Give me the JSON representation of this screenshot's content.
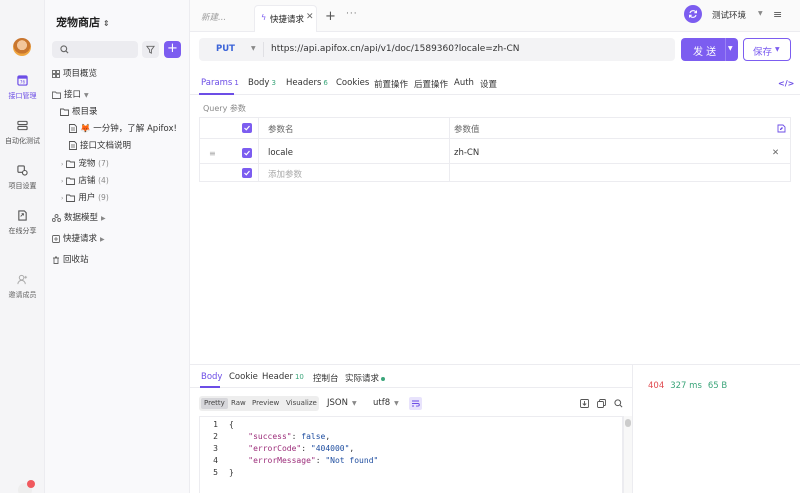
{
  "rail": {
    "items": [
      {
        "label": "接口管理",
        "icon": "api-icon",
        "active": true
      },
      {
        "label": "自动化测试",
        "icon": "automation-icon",
        "active": false
      },
      {
        "label": "项目设置",
        "icon": "settings-icon",
        "active": false
      },
      {
        "label": "在线分享",
        "icon": "share-icon",
        "active": false
      },
      {
        "label": "邀请成员",
        "icon": "invite-icon",
        "active": false
      }
    ],
    "notification_count": "1"
  },
  "panel": {
    "project_name": "宠物商店",
    "search": {
      "placeholder": ""
    },
    "overview": "项目概览",
    "api_section": "接口",
    "root_dir": "根目录",
    "docs": [
      "🦊 一分钟，了解 Apifox!",
      "接口文档说明"
    ],
    "folders": [
      {
        "name": "宠物",
        "count": "(7)"
      },
      {
        "name": "店铺",
        "count": "(4)"
      },
      {
        "name": "用户",
        "count": "(9)"
      }
    ],
    "data_models": "数据模型",
    "quick_requests": "快捷请求",
    "recycle_bin": "回收站"
  },
  "tabs": {
    "new_tab": "新建...",
    "active_tab": "快捷请求",
    "more": "···",
    "environment": "测试环境"
  },
  "request": {
    "method": "PUT",
    "url": "https://api.apifox.cn/api/v1/doc/1589360?locale=zh-CN",
    "send_label": "发 送",
    "save_label": "保存"
  },
  "request_tabs": [
    {
      "label": "Params",
      "count": "1",
      "active": true
    },
    {
      "label": "Body",
      "count": "3"
    },
    {
      "label": "Headers",
      "count": "6"
    },
    {
      "label": "Cookies",
      "count": ""
    },
    {
      "label": "前置操作",
      "count": ""
    },
    {
      "label": "后置操作",
      "count": ""
    },
    {
      "label": "Auth",
      "count": ""
    },
    {
      "label": "设置",
      "count": ""
    }
  ],
  "query": {
    "title": "Query 参数",
    "header_name": "参数名",
    "header_value": "参数值",
    "rows": [
      {
        "name": "locale",
        "value": "zh-CN",
        "checked": true
      }
    ],
    "add_placeholder": "添加参数"
  },
  "response_tabs": [
    {
      "label": "Body",
      "count": "",
      "active": true
    },
    {
      "label": "Cookie",
      "count": ""
    },
    {
      "label": "Header",
      "count": "10"
    },
    {
      "label": "控制台",
      "count": ""
    },
    {
      "label": "实际请求",
      "count": ""
    }
  ],
  "response": {
    "status_code": "404",
    "time": "327 ms",
    "size": "65 B",
    "formats": [
      "Pretty",
      "Raw",
      "Preview",
      "Visualize"
    ],
    "active_format": "Pretty",
    "language": "JSON",
    "encoding": "utf8",
    "line_numbers": [
      "1",
      "2",
      "3",
      "4",
      "5"
    ],
    "body": {
      "open": "{",
      "lines": [
        {
          "key": "\"success\"",
          "value": "false"
        },
        {
          "key": "\"errorCode\"",
          "value": "\"404000\""
        },
        {
          "key": "\"errorMessage\"",
          "value": "\"Not found\""
        }
      ],
      "close": "}"
    }
  },
  "colors": {
    "accent": "#7c5df0",
    "method_put": "#3b63d8",
    "error": "#e0494e",
    "success": "#3ba57a"
  }
}
